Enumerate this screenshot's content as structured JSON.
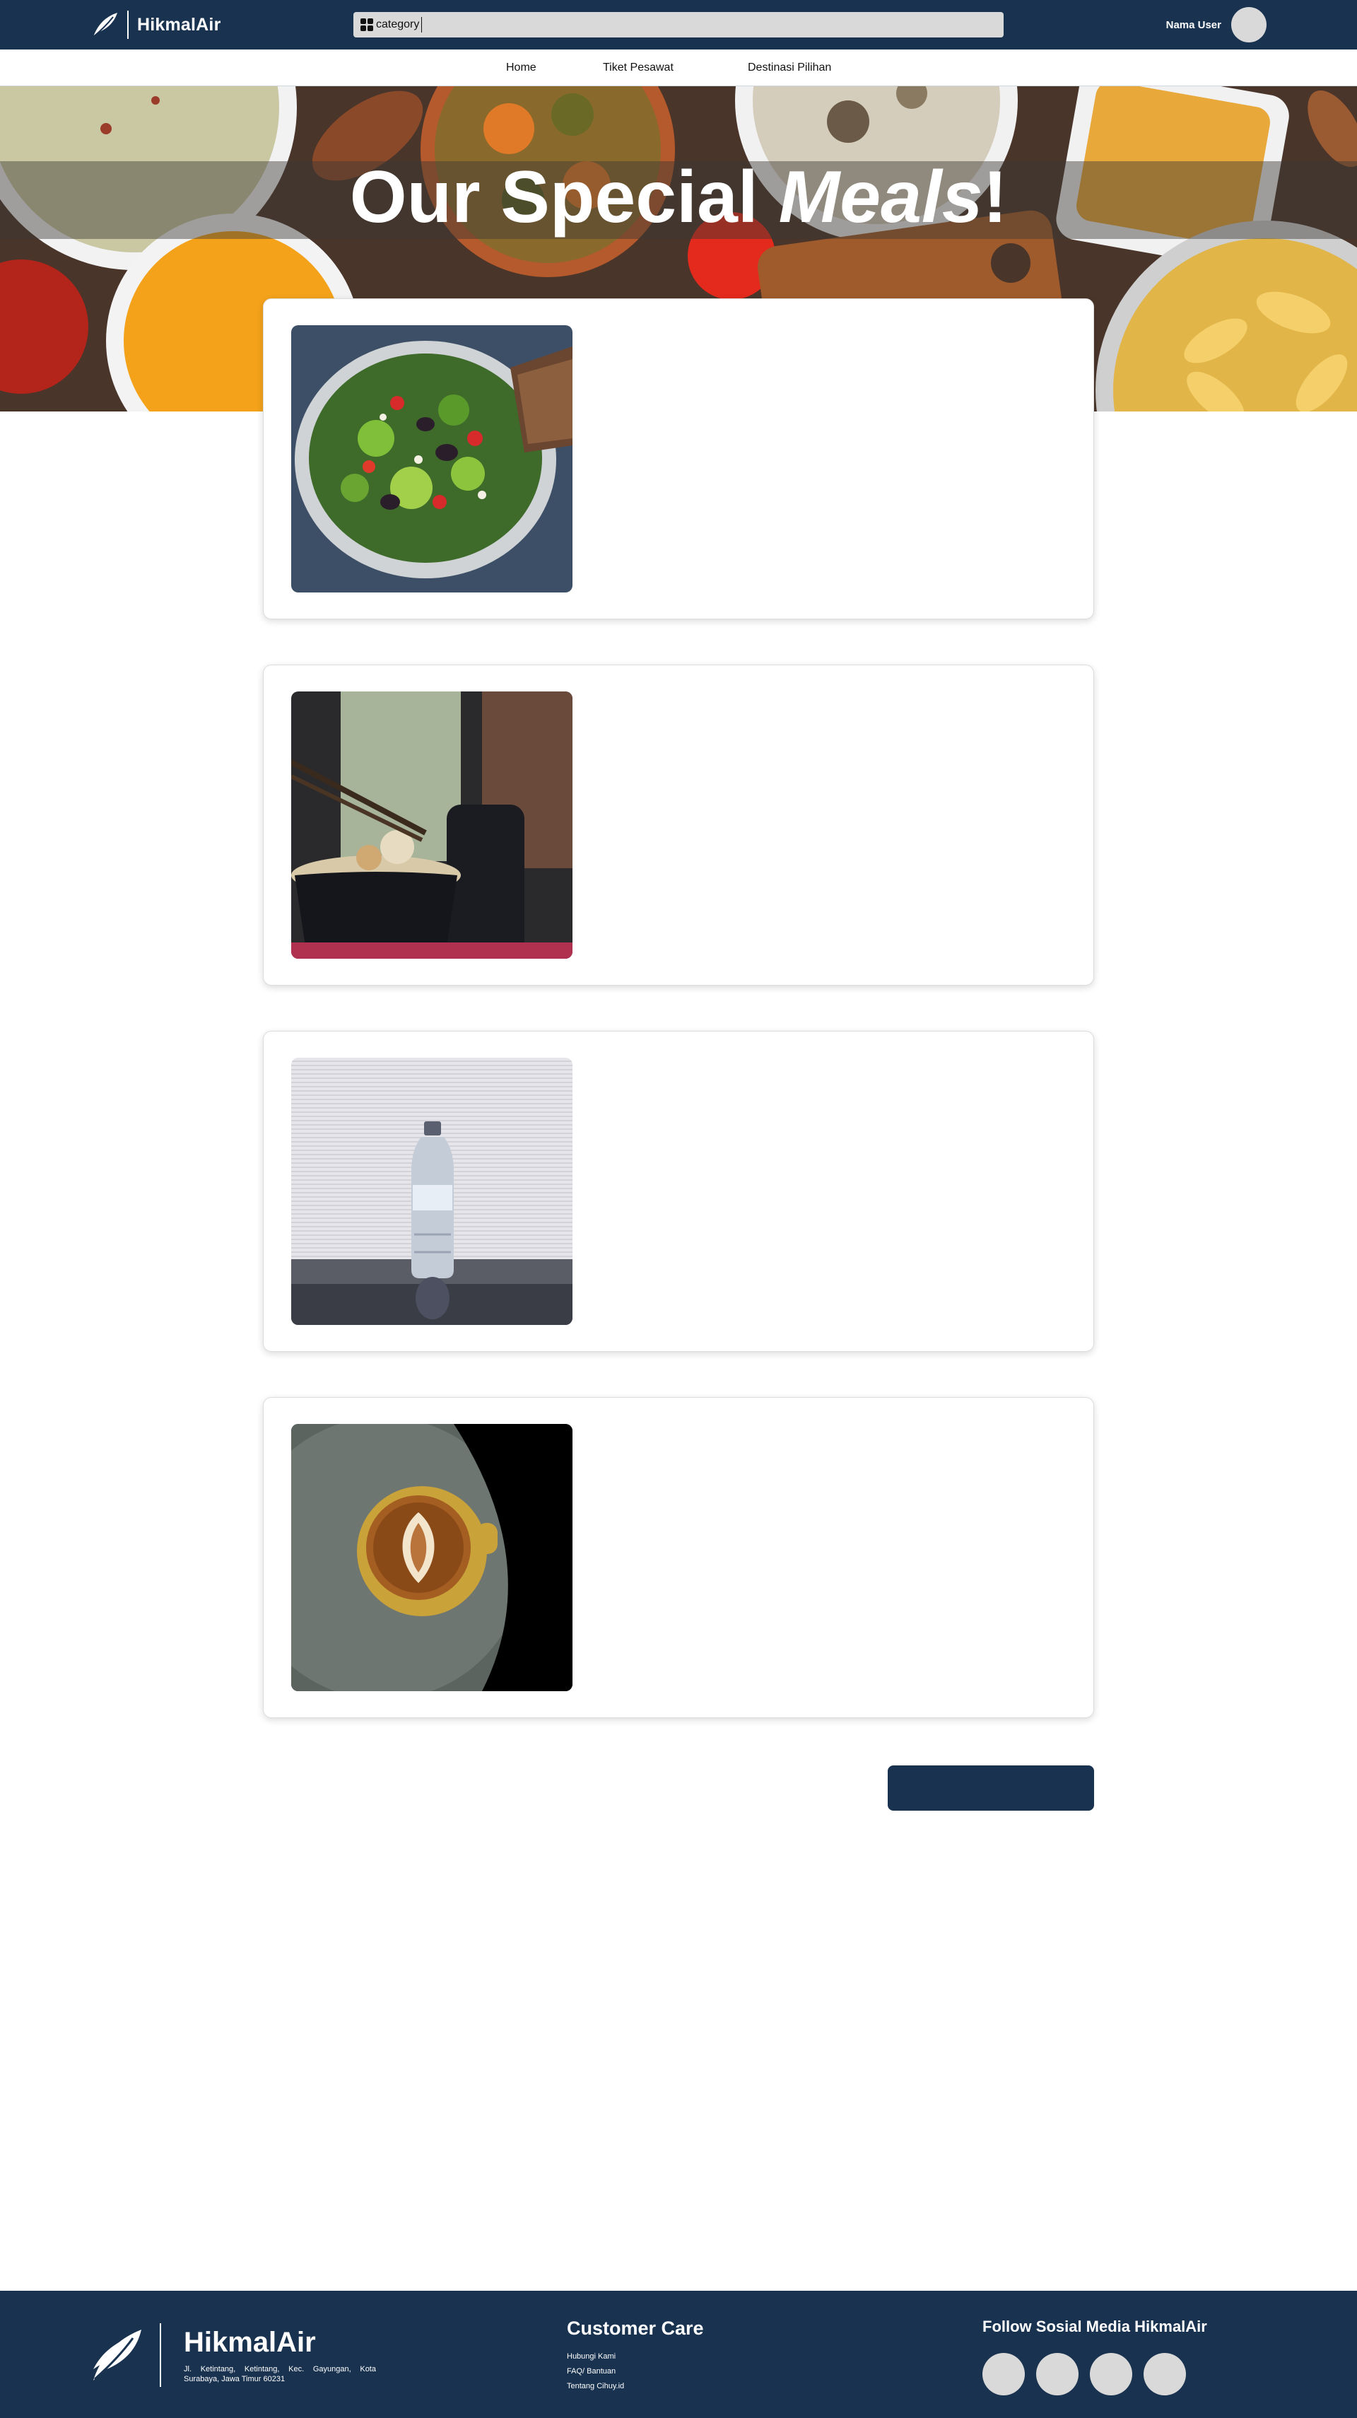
{
  "header": {
    "brand_name": "HikmalAir",
    "search": {
      "category_label": "category",
      "value": ""
    },
    "user_name": "Nama User"
  },
  "nav": {
    "items": [
      {
        "label": "Home"
      },
      {
        "label": "Tiket Pesawat"
      },
      {
        "label": "Destinasi Pilihan"
      }
    ]
  },
  "hero": {
    "title_regular": "Our Special ",
    "title_italic": "Meals",
    "title_suffix": "!"
  },
  "meals": [
    {
      "image": "salad-photo"
    },
    {
      "image": "rice-bowl-photo"
    },
    {
      "image": "water-bottle-photo"
    },
    {
      "image": "coffee-latte-photo"
    }
  ],
  "footer": {
    "brand_name": "HikmalAir",
    "address": "Jl. Ketintang, Ketintang, Kec. Gayungan, Kota Surabaya, Jawa Timur 60231",
    "customer_care": {
      "title": "Customer Care",
      "links": [
        "Hubungi Kami",
        "FAQ/ Bantuan",
        "Tentang Cihuy.id"
      ]
    },
    "social": {
      "title": "Follow Sosial Media HikmalAir"
    }
  },
  "colors": {
    "primary": "#183250",
    "placeholder_gray": "#d9d9d9",
    "background": "#ffffff"
  }
}
